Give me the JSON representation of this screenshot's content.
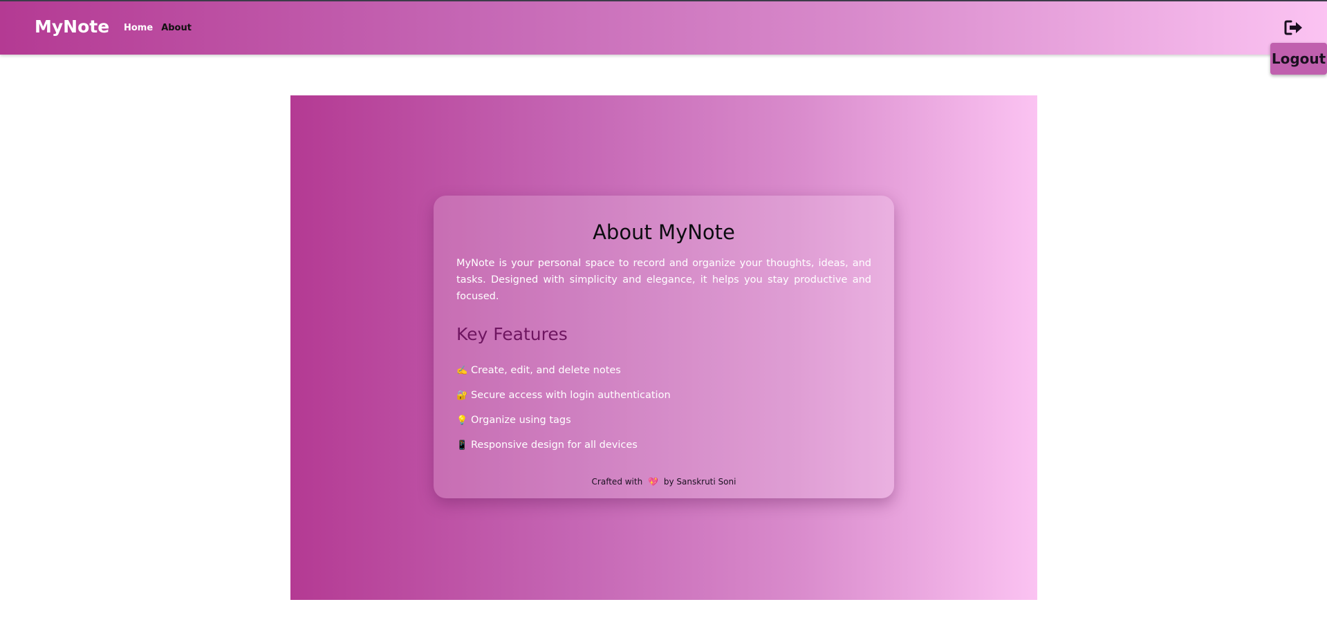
{
  "navbar": {
    "brand": "MyNote",
    "links": [
      {
        "label": "Home"
      },
      {
        "label": "About"
      }
    ],
    "logout_icon": "sign-out-icon",
    "logout_label": "Logout"
  },
  "about": {
    "title": "About MyNote",
    "description": "MyNote is your personal space to record and organize your thoughts, ideas, and tasks. Designed with simplicity and elegance, it helps you stay productive and focused.",
    "features_title": "Key Features",
    "features": [
      {
        "icon": "✍️",
        "icon_name": "writing-hand-icon",
        "text": "Create, edit, and delete notes"
      },
      {
        "icon": "🔐",
        "icon_name": "lock-icon",
        "text": "Secure access with login authentication"
      },
      {
        "icon": "💡",
        "icon_name": "lightbulb-icon",
        "text": "Organize using tags"
      },
      {
        "icon": "📱",
        "icon_name": "mobile-phone-icon",
        "text": "Responsive design for all devices"
      }
    ],
    "footer": {
      "prefix": "Crafted with",
      "heart": "💖",
      "suffix": "by Sanskruti Soni"
    }
  },
  "colors": {
    "gradient_start": "#b43a93",
    "gradient_end": "#fbc3f2",
    "features_title": "#6e1560",
    "logout_button": "#c060ae"
  }
}
